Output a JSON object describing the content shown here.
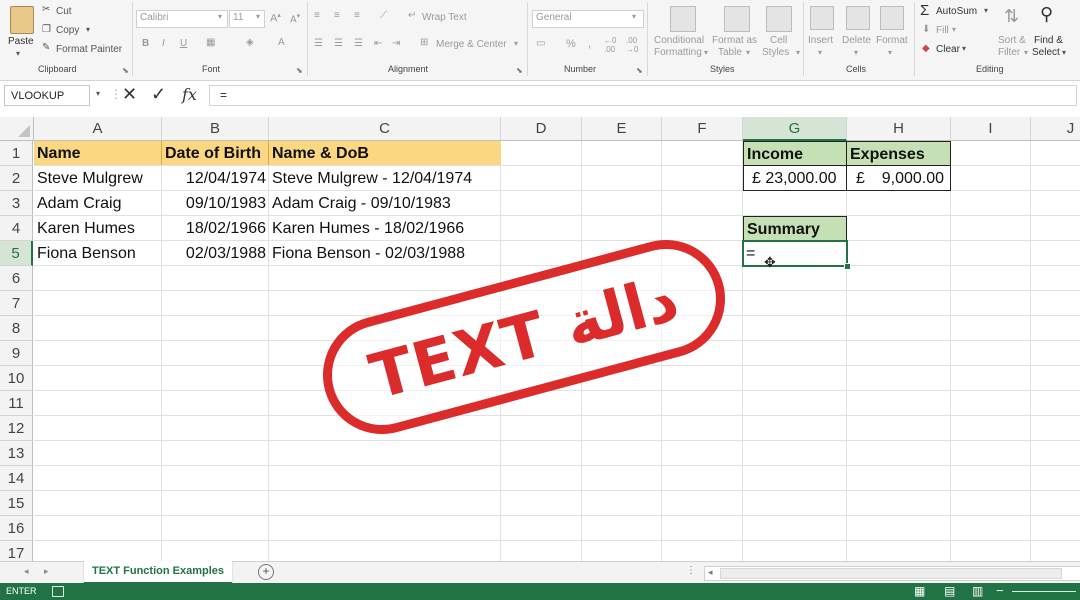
{
  "ribbon": {
    "clipboard": {
      "paste": "Paste",
      "cut": "Cut",
      "copy": "Copy",
      "format_painter": "Format Painter",
      "label": "Clipboard"
    },
    "font": {
      "name": "Calibri",
      "size": "11",
      "label": "Font"
    },
    "alignment": {
      "wrap_text": "Wrap Text",
      "merge_center": "Merge & Center",
      "label": "Alignment"
    },
    "number": {
      "format": "General",
      "label": "Number"
    },
    "styles": {
      "conditional": "Conditional",
      "formatting": "Formatting",
      "format_as": "Format as",
      "table": "Table",
      "cell": "Cell",
      "styles_btn": "Styles",
      "label": "Styles"
    },
    "cells": {
      "insert": "Insert",
      "delete": "Delete",
      "format": "Format",
      "label": "Cells"
    },
    "editing": {
      "autosum": "AutoSum",
      "fill": "Fill",
      "clear": "Clear",
      "sort": "Sort &",
      "filter": "Filter",
      "find": "Find &",
      "select": "Select",
      "label": "Editing"
    }
  },
  "formula_bar": {
    "name_box": "VLOOKUP",
    "content": "="
  },
  "columns": [
    "A",
    "B",
    "C",
    "D",
    "E",
    "F",
    "G",
    "H",
    "I",
    "J"
  ],
  "rows": [
    "1",
    "2",
    "3",
    "4",
    "5",
    "6",
    "7",
    "8",
    "9",
    "10",
    "11",
    "12",
    "13",
    "14",
    "15",
    "16",
    "17"
  ],
  "cells": {
    "A1": "Name",
    "B1": "Date of Birth",
    "C1": "Name & DoB",
    "A2": "Steve Mulgrew",
    "B2": "12/04/1974",
    "C2": "Steve Mulgrew - 12/04/1974",
    "A3": "Adam Craig",
    "B3": "09/10/1983",
    "C3": "Adam Craig - 09/10/1983",
    "A4": "Karen Humes",
    "B4": "18/02/1966",
    "C4": "Karen Humes - 18/02/1966",
    "A5": "Fiona Benson",
    "B5": "02/03/1988",
    "C5": "Fiona Benson - 02/03/1988",
    "G1": "Income",
    "H1": "Expenses",
    "G2": "£ 23,000.00",
    "H2_sym": "£",
    "H2": "9,000.00",
    "G4": "Summary",
    "G5": "="
  },
  "sheet_tab": "TEXT Function Examples",
  "status": "ENTER",
  "stamp": "TEXT دالة",
  "colors": {
    "header_fill": "#fbd781",
    "green_fill": "#c5e0b4",
    "excel_green": "#217346",
    "stamp_red": "#dc2b2b"
  }
}
